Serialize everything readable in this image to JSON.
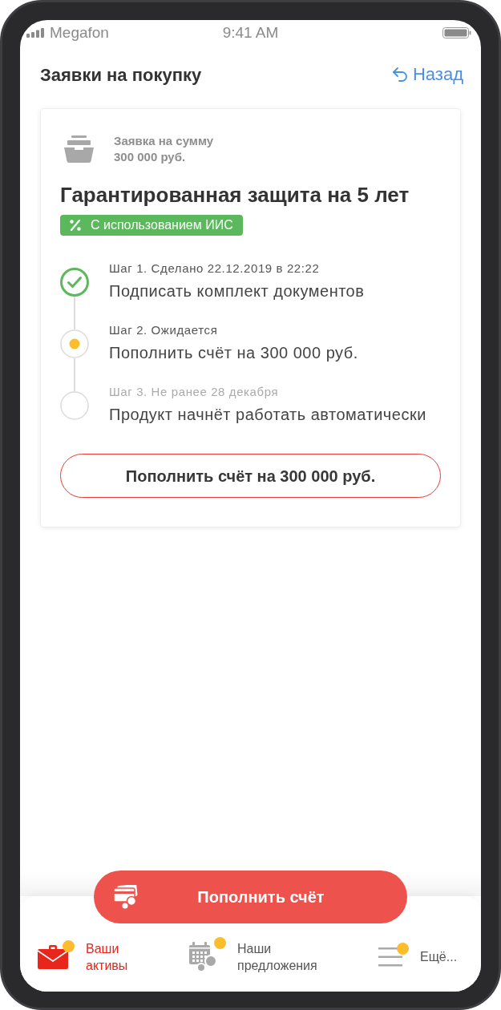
{
  "status_bar": {
    "carrier": "Megafon",
    "time": "9:41 AM"
  },
  "header": {
    "title": "Заявки на покупку",
    "back": "Назад"
  },
  "card": {
    "amount_label": "Заявка на сумму",
    "amount": "300 000 руб.",
    "title": "Гарантированная защита на 5 лет",
    "badge": "С использованием ИИС",
    "steps": [
      {
        "kind": "done",
        "caption": "Шаг 1. Сделано 22.12.2019 в 22:22",
        "text": "Подписать комплект документов"
      },
      {
        "kind": "pending",
        "caption": "Шаг 2. Ожидается",
        "text": "Пополнить счёт на 300 000 руб."
      },
      {
        "kind": "future",
        "caption": "Шаг 3. Не ранее 28 декабря",
        "text": "Продукт начнёт работать автоматически"
      }
    ],
    "button": "Пополнить счёт на 300 000 руб."
  },
  "fab": {
    "label": "Пополнить счёт"
  },
  "tab_bar": [
    {
      "kind": "assets",
      "label": "Ваши активы",
      "selected": true,
      "badge": true
    },
    {
      "kind": "offers",
      "label": "Наши предложения",
      "selected": false,
      "badge": true
    },
    {
      "kind": "more",
      "label": "Ещё...",
      "selected": false,
      "badge": true
    }
  ]
}
